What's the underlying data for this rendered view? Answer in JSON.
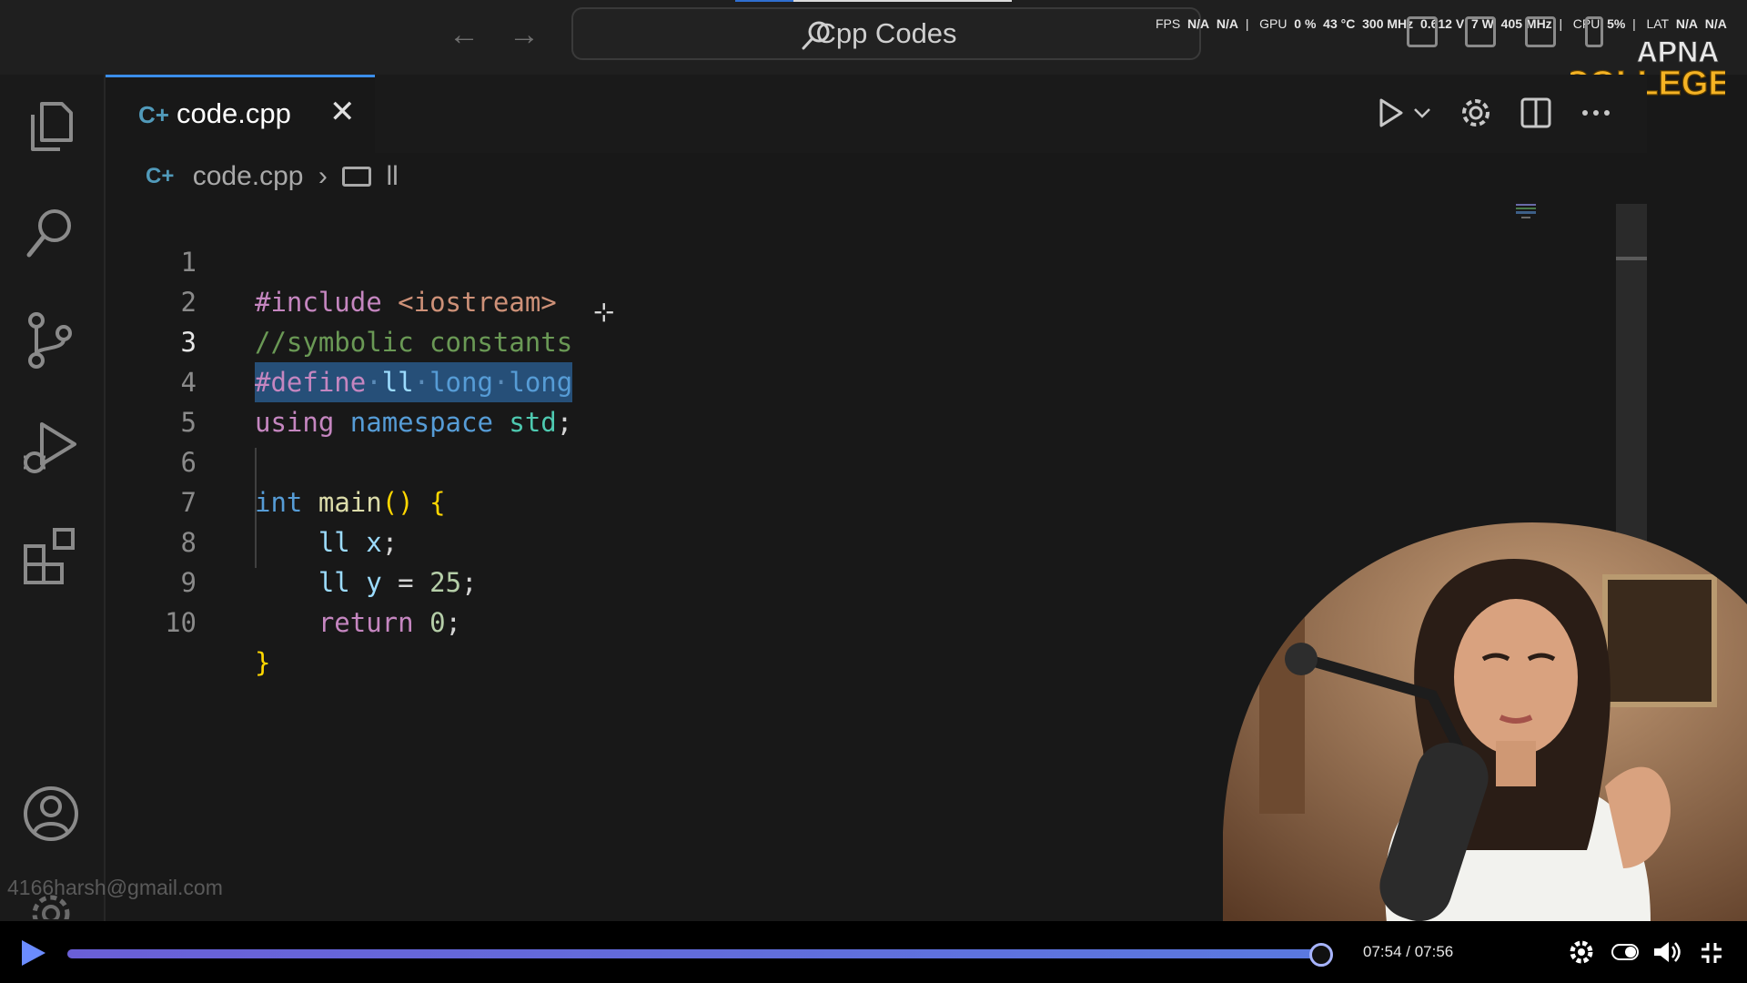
{
  "title_bar": {
    "search_label": "Cpp Codes",
    "stats": {
      "fps_label": "FPS",
      "fps_value_1": "N/A",
      "fps_value_2": "N/A",
      "gpu_label": "GPU",
      "gpu_usage": "0 %",
      "gpu_temp": "43 °C",
      "gpu_clock": "300 MHz",
      "gpu_volt": "0.612 V",
      "gpu_power": "7 W",
      "gpu_mem_clock": "405 MHz",
      "cpu_label": "CPU",
      "cpu_usage": "5%",
      "lat_label": "LAT",
      "lat_value_1": "N/A",
      "lat_value_2": "N/A"
    }
  },
  "logo": {
    "line1": "APNA",
    "line2": "COLLEGE"
  },
  "tab": {
    "label": "code.cpp",
    "icon": "C++"
  },
  "breadcrumb": {
    "file": "code.cpp",
    "symbol": "ll"
  },
  "code": {
    "lines": [
      {
        "n": "1"
      },
      {
        "n": "2"
      },
      {
        "n": "3"
      },
      {
        "n": "4"
      },
      {
        "n": "5"
      },
      {
        "n": "6"
      },
      {
        "n": "7"
      },
      {
        "n": "8"
      },
      {
        "n": "9"
      },
      {
        "n": "10"
      }
    ],
    "l1_a": "#include",
    "l1_b": "<iostream>",
    "l2": "//symbolic constants",
    "l3_a": "#define",
    "l3_b": "ll",
    "l3_c": "long",
    "l3_d": "long",
    "l4_a": "using",
    "l4_b": "namespace",
    "l4_c": "std",
    "l4_d": ";",
    "l6_a": "int",
    "l6_b": "main",
    "l6_c": "()",
    "l6_d": "{",
    "l7_a": "ll",
    "l7_b": "x",
    "l7_c": ";",
    "l8_a": "ll",
    "l8_b": "y",
    "l8_c": "=",
    "l8_d": "25",
    "l8_e": ";",
    "l9_a": "return",
    "l9_b": "0",
    "l9_c": ";",
    "l10": "}"
  },
  "account_email": "4166harsh@gmail.com",
  "player": {
    "time": "07:54 / 07:56",
    "progress": 0.996
  },
  "colors": {
    "accent": "#3b8eea",
    "selection": "#264f78",
    "logo": "#f5b324"
  }
}
